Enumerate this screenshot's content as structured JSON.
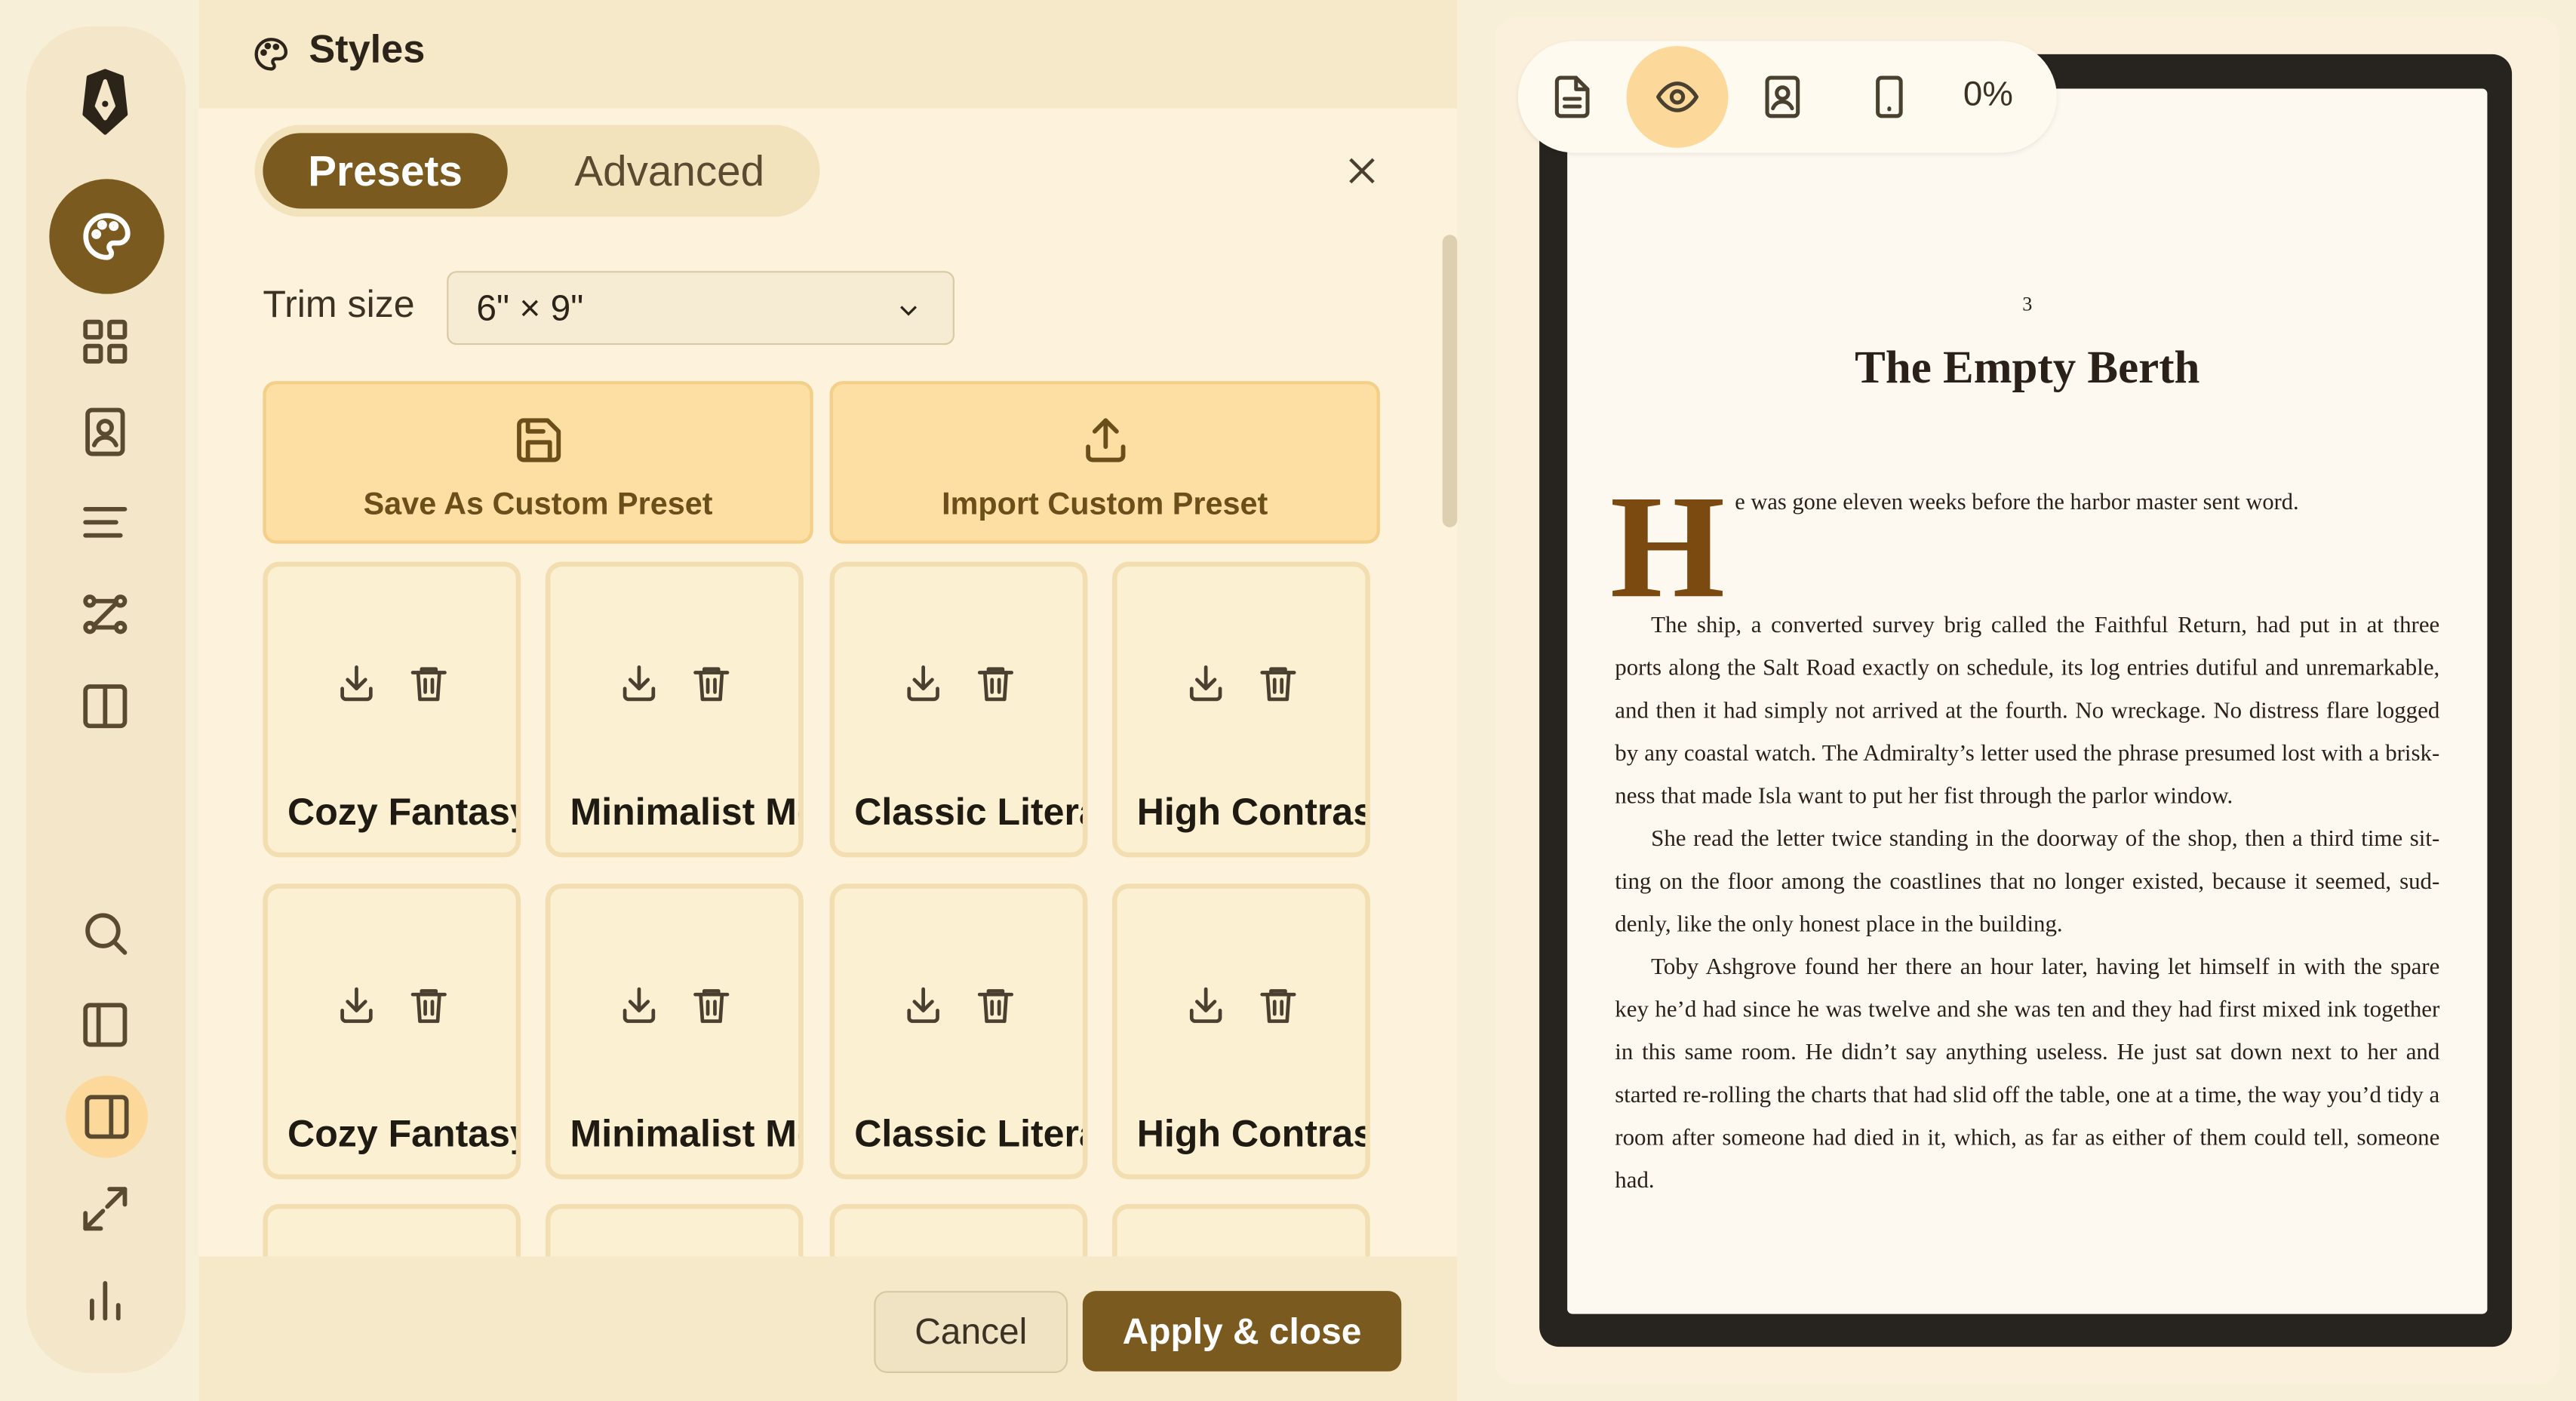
{
  "app": {
    "colors": {
      "accent": "#7a5a1e",
      "accent_soft": "#fcd99b",
      "panel_bg": "#fdf3dc",
      "rail_bg": "#f3e6c9"
    }
  },
  "rail": {
    "items": [
      {
        "icon": "logo-pen-icon"
      },
      {
        "icon": "palette-icon",
        "active": true
      },
      {
        "icon": "grid-icon"
      },
      {
        "icon": "contact-book-icon"
      },
      {
        "icon": "align-left-icon"
      },
      {
        "icon": "workflow-icon"
      },
      {
        "icon": "columns-icon"
      },
      {
        "icon": "search-icon"
      },
      {
        "icon": "sidebar-left-icon"
      },
      {
        "icon": "sidebar-right-icon",
        "highlight": true
      },
      {
        "icon": "expand-icon"
      },
      {
        "icon": "bar-chart-icon"
      }
    ]
  },
  "panel": {
    "title": "Styles",
    "tabs": [
      {
        "label": "Presets",
        "active": true
      },
      {
        "label": "Advanced",
        "active": false
      }
    ],
    "trim": {
      "label": "Trim size",
      "value": "6\" × 9\""
    },
    "actions": {
      "save": "Save As Custom Preset",
      "import": "Import Custom Preset"
    },
    "presets": [
      {
        "name": "Cozy Fantasy"
      },
      {
        "name": "Minimalist Modern"
      },
      {
        "name": "Classic Literary"
      },
      {
        "name": "High Contrast"
      },
      {
        "name": "Cozy Fantasy"
      },
      {
        "name": "Minimalist Modern"
      },
      {
        "name": "Classic Literary"
      },
      {
        "name": "High Contrast"
      }
    ],
    "footer": {
      "cancel": "Cancel",
      "apply": "Apply & close"
    }
  },
  "preview": {
    "toolbar": {
      "zoom": "0%"
    },
    "page_number": "3",
    "chapter_title": "The Empty Berth",
    "dropcap": "H",
    "first_line": "e was gone eleven weeks before the harbor master sent word.",
    "paragraphs": [
      "The ship, a converted survey brig called the Faithful Return, had put in at three ports along the Salt Road exactly on schedule, its log entries dutiful and unremarkable, and then it had simply not arrived at the fourth. No wreckage. No distress flare logged by any coastal watch. The Admiralty’s letter used the phrase presumed lost with a brisk-ness that made Isla want to put her fist through the parlor window.",
      "She read the letter twice standing in the doorway of the shop, then a third time sit-ting on the floor among the coastlines that no longer existed, because it seemed, sud-denly, like the only honest place in the building.",
      "Toby Ashgrove found her there an hour later, having let himself in with the spare key he’d had since he was twelve and she was ten and they had first mixed ink together in this same room. He didn’t say anything useless. He just sat down next to her and started re-rolling the charts that had slid off the table, one at a time, the way you’d tidy a room after someone had died in it, which, as far as either of them could tell, someone had."
    ]
  }
}
